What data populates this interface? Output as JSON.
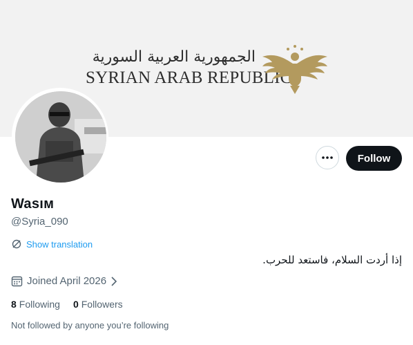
{
  "banner": {
    "title_ar": "الجمهورية العربية السورية",
    "title_en": "SYRIAN ARAB REPUBLIC",
    "emblem_icon": "eagle-emblem-icon",
    "emblem_color": "#b39a5e"
  },
  "profile": {
    "display_name": "Wasıм",
    "handle": "@Syria_090",
    "show_translation": "Show translation",
    "bio": "إذا أردت السلام، فاستعد للحرب.",
    "joined": "Joined April 2026",
    "following_count": "8",
    "following_label": "Following",
    "followers_count": "0",
    "followers_label": "Followers",
    "not_followed_note": "Not followed by anyone you’re following"
  },
  "actions": {
    "more_icon": "more-dots-icon",
    "follow_label": "Follow"
  },
  "colors": {
    "accent": "#1d9bf0",
    "text": "#0f1419",
    "muted": "#536471",
    "button_bg": "#0f1419"
  }
}
